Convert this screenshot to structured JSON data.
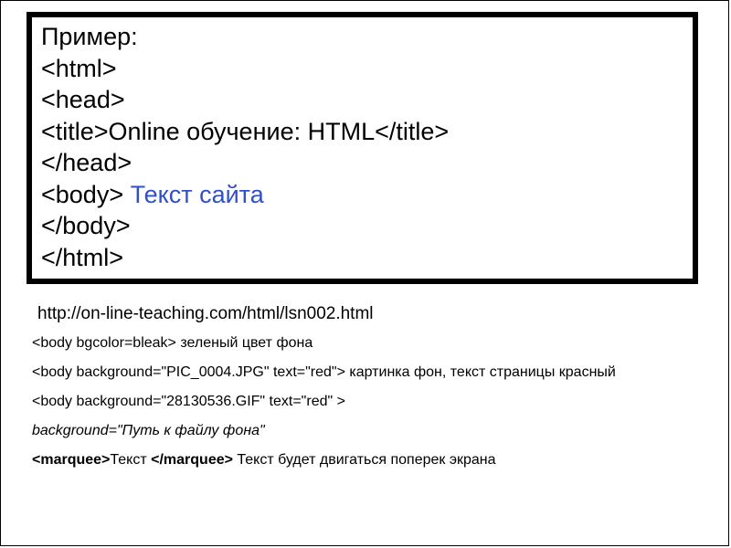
{
  "box": {
    "l1": "Пример:",
    "l2": "<html>",
    "l3": "<head>",
    "l4a": " <title>Online обучение: HTML</title>",
    "l5": "</head>",
    "l6a": "<body> ",
    "l6b": "Текст сайта",
    "l7": "</body>",
    "l8": " </html>"
  },
  "url": "http://on-line-teaching.com/html/lsn002.html",
  "anno": {
    "a1": "<body bgcolor=bleak> зеленый цвет фона",
    "a2": "<body background=\"PIC_0004.JPG\"  text=\"red\">  картинка фон, текст страницы красный",
    "a3": "<body background=\"28130536.GIF\"  text=\"red\" >",
    "a4": "background=\"Путь к файлу фона\"",
    "a5a": "<marquee>",
    "a5b": "Текст ",
    "a5c": "</marquee>",
    "a5d": "  Текст будет двигаться поперек экрана"
  }
}
